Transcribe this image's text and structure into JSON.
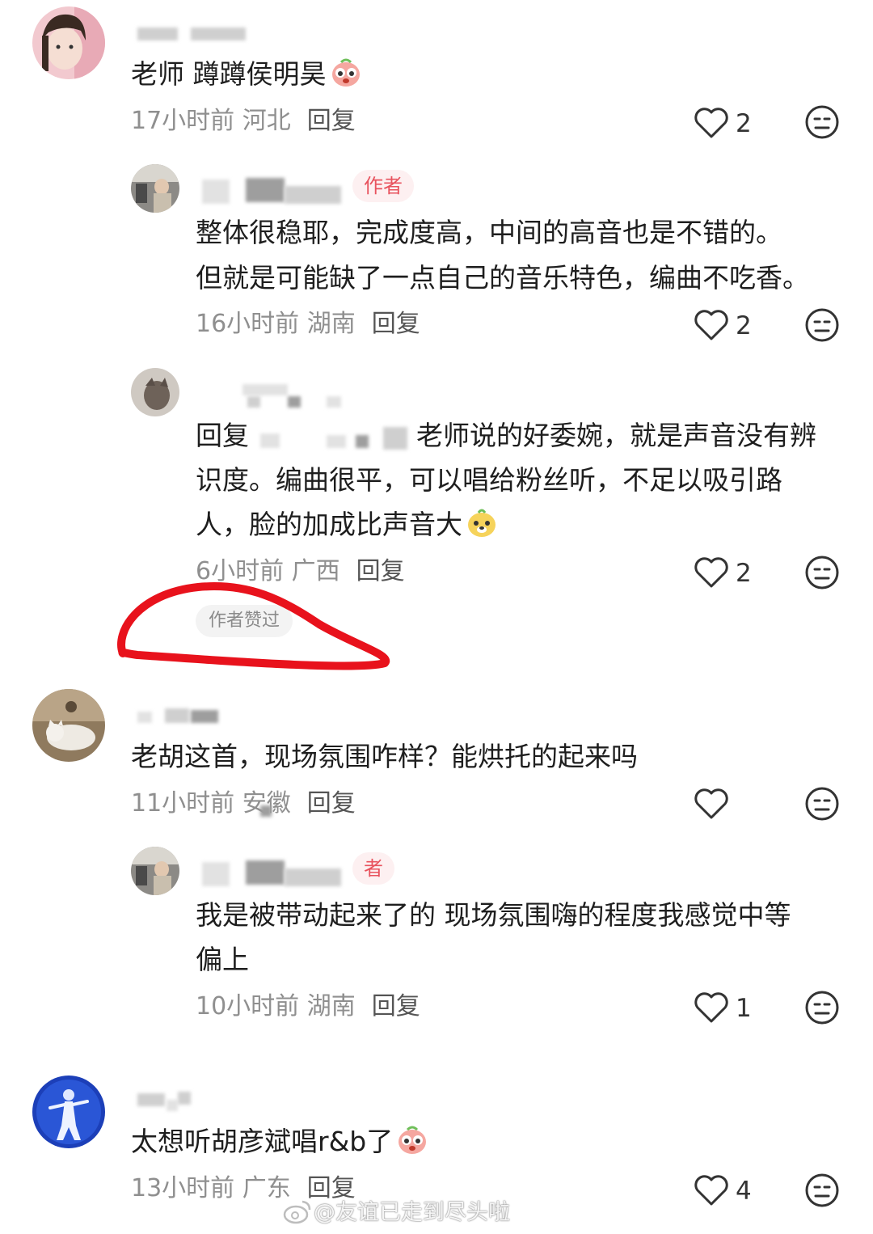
{
  "comments": [
    {
      "text": "老师 蹲蹲侯明昊",
      "time": "17小时前",
      "location": "河北",
      "reply_label": "回复",
      "likes": "2"
    },
    {
      "author_badge": "作者",
      "line1": "整体很稳耶，完成度高，中间的高音也是不错的。",
      "line2": "但就是可能缺了一点自己的音乐特色，编曲不吃香。",
      "time": "16小时前",
      "location": "湖南",
      "reply_label": "回复",
      "likes": "2"
    },
    {
      "reply_prefix": "回复",
      "line1_tail": "老师说的好委婉，就是声音没有辨",
      "line2": "识度。编曲很平，可以唱给粉丝听，不足以吸引路",
      "line3": "人，脸的加成比声音大",
      "time": "6小时前",
      "location": "广西",
      "reply_label": "回复",
      "likes": "2",
      "liked_by_author": "作者赞过"
    },
    {
      "text": "老胡这首，现场氛围咋样？能烘托的起来吗",
      "time": "11小时前",
      "location": "安徽",
      "reply_label": "回复",
      "likes": ""
    },
    {
      "author_badge": "者",
      "line1": "我是被带动起来了的 现场氛围嗨的程度我感觉中等",
      "line2": "偏上",
      "time": "10小时前",
      "location": "湖南",
      "reply_label": "回复",
      "likes": "1"
    },
    {
      "text": "太想听胡彦斌唱r&b了",
      "time": "13小时前",
      "location": "广东",
      "reply_label": "回复",
      "likes": "4"
    }
  ],
  "watermark": "@友谊已走到尽头啦",
  "colors": {
    "author_badge_bg": "#fdf0f1",
    "author_badge_text": "#e8535e",
    "annotation_circle": "#e8121c"
  },
  "icons": [
    "heart-icon",
    "neutral-face-icon",
    "crying-emoji-icon",
    "dog-emoji-icon",
    "weibo-logo-icon"
  ]
}
